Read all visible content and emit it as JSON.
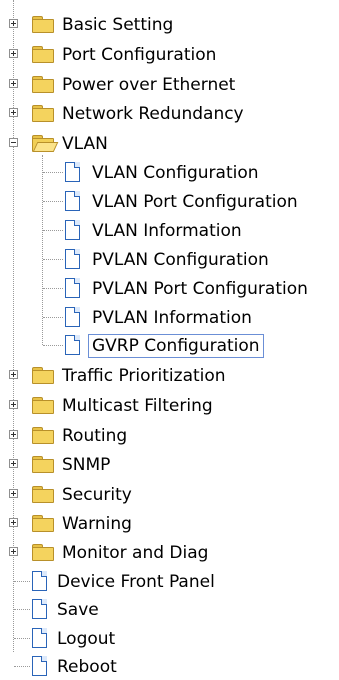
{
  "tree": {
    "folders_top": [
      {
        "label": "Basic Setting"
      },
      {
        "label": "Port Configuration"
      },
      {
        "label": "Power over Ethernet"
      },
      {
        "label": "Network Redundancy"
      }
    ],
    "vlan": {
      "label": "VLAN",
      "children": [
        {
          "label": "VLAN Configuration"
        },
        {
          "label": "VLAN Port Configuration"
        },
        {
          "label": "VLAN Information"
        },
        {
          "label": "PVLAN Configuration"
        },
        {
          "label": "PVLAN Port Configuration"
        },
        {
          "label": "PVLAN Information"
        },
        {
          "label": "GVRP Configuration"
        }
      ]
    },
    "folders_bottom": [
      {
        "label": "Traffic Prioritization"
      },
      {
        "label": "Multicast Filtering"
      },
      {
        "label": "Routing"
      },
      {
        "label": "SNMP"
      },
      {
        "label": "Security"
      },
      {
        "label": "Warning"
      },
      {
        "label": "Monitor and Diag"
      }
    ],
    "pages": [
      {
        "label": "Device Front Panel"
      },
      {
        "label": "Save"
      },
      {
        "label": "Logout"
      },
      {
        "label": "Reboot"
      }
    ]
  }
}
